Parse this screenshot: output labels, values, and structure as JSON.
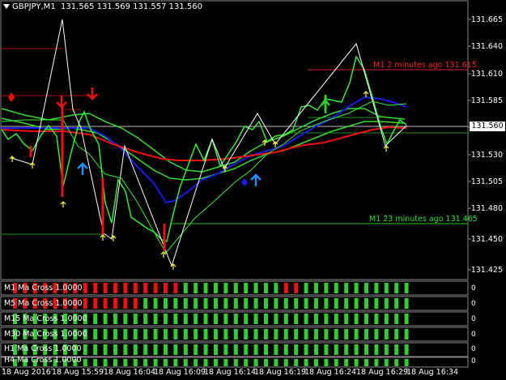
{
  "header": {
    "symbol": "GBPJPY,M1",
    "ohlc": "131.565 131.569 131.557 131.560"
  },
  "price_axis": [
    "131.665",
    "131.640",
    "131.610",
    "131.585",
    "131.560",
    "131.530",
    "131.505",
    "131.480",
    "131.450",
    "131.425"
  ],
  "current_price": "131.560",
  "hlines": [
    {
      "label": "M1 2 minutes ago 131.615",
      "color": "#ff2020"
    },
    {
      "label": "M1 23 minutes ago 131.465",
      "color": "#30e030"
    }
  ],
  "time_axis": [
    "18 Aug 2016",
    "18 Aug 15:59",
    "18 Aug 16:04",
    "18 Aug 16:09",
    "18 Aug 16:14",
    "18 Aug 16:19",
    "18 Aug 16:24",
    "18 Aug 16:29",
    "18 Aug 16:34"
  ],
  "subpanels": [
    {
      "label": "M1  Ma Cross 1.0000",
      "value": "0"
    },
    {
      "label": "M5  Ma Cross 1.0000",
      "value": "0"
    },
    {
      "label": "M15  Ma Cross 1.0000",
      "value": "0"
    },
    {
      "label": "M30  Ma Cross 1.0000",
      "value": "0"
    },
    {
      "label": "H1  Ma Cross 1.0000",
      "value": "0"
    },
    {
      "label": "H4  Ma Cross 1.0000",
      "value": "0"
    }
  ],
  "colors": {
    "up": "#33cc33",
    "down": "#ee1111",
    "ma_blue": "#1a1aee",
    "ma_red": "#ee1111",
    "ma_green": "#33dd33",
    "zigzag": "#ffffff"
  }
}
